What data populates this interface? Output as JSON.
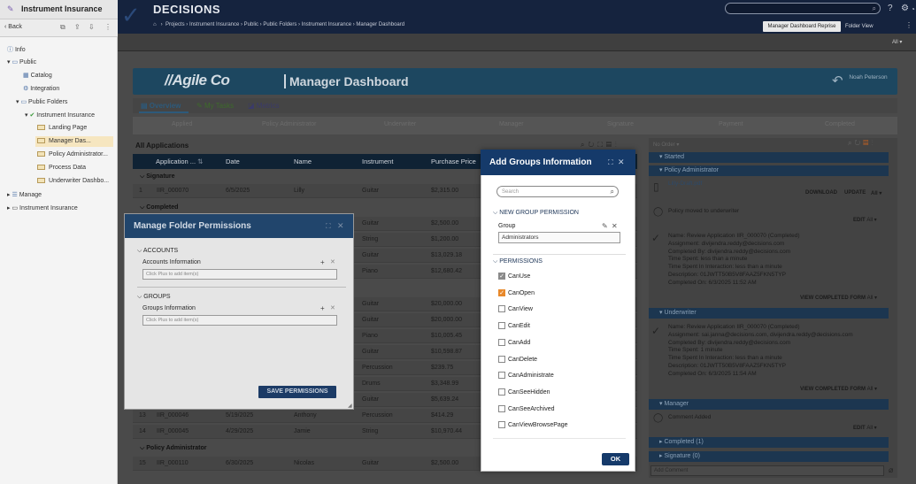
{
  "left_panel": {
    "title": "Instrument Insurance",
    "back": "Back",
    "tree": [
      "Info",
      "Public",
      "Catalog",
      "Integration",
      "Public Folders",
      "Instrument Insurance",
      "Landing Page",
      "Manager Das...",
      "Policy Administrator...",
      "Process Data",
      "Underwriter Dashbo...",
      "Manage",
      "Instrument Insurance"
    ]
  },
  "topbar": {
    "brand": "DECISIONS",
    "breadcrumb": "Projects  ›  Instrument Insurance  ›  Public  ›  Public Folders  ›  Instrument Insurance  ›  Manager Dashboard",
    "reprise_btn": "Manager Dashboard Reprise",
    "folder_view": "Folder View",
    "all": "All"
  },
  "dashboard": {
    "logo": "//Agile Co",
    "title": "Manager Dashboard",
    "user": "Noah Peterson",
    "tabs": [
      "Overview",
      "My Tasks",
      "Metrics"
    ],
    "steps": [
      "Applied",
      "Policy Administrator",
      "Underwriter",
      "Manager",
      "Signature",
      "Payment",
      "Completed"
    ],
    "table_title": "All Applications"
  },
  "table": {
    "headers": [
      "Application ...",
      "Date",
      "Name",
      "Instrument",
      "Purchase Price"
    ],
    "groups": [
      "Signature",
      "Completed",
      "Policy Administrator"
    ],
    "rows": [
      {
        "n": "1",
        "id": "IIR_000070",
        "date": "6/5/2025",
        "name": "Lilly",
        "instrument": "Guitar",
        "price": "$2,315.00"
      },
      {
        "n": "",
        "id": "",
        "date": "",
        "name": "",
        "instrument": "Guitar",
        "price": "$2,500.00"
      },
      {
        "n": "",
        "id": "",
        "date": "",
        "name": "",
        "instrument": "String",
        "price": "$1,200.00"
      },
      {
        "n": "",
        "id": "",
        "date": "",
        "name": "",
        "instrument": "Guitar",
        "price": "$13,029.18"
      },
      {
        "n": "",
        "id": "",
        "date": "",
        "name": "",
        "instrument": "Piano",
        "price": "$12,680.42"
      },
      {
        "n": "",
        "id": "",
        "date": "",
        "name": "",
        "instrument": "Guitar",
        "price": "$20,000.00"
      },
      {
        "n": "",
        "id": "",
        "date": "",
        "name": "",
        "instrument": "Guitar",
        "price": "$20,000.00"
      },
      {
        "n": "",
        "id": "",
        "date": "",
        "name": "",
        "instrument": "Piano",
        "price": "$10,005.45"
      },
      {
        "n": "",
        "id": "",
        "date": "",
        "name": "",
        "instrument": "Guitar",
        "price": "$10,598.87"
      },
      {
        "n": "",
        "id": "",
        "date": "",
        "name": "",
        "instrument": "Percussion",
        "price": "$239.75"
      },
      {
        "n": "",
        "id": "",
        "date": "",
        "name": "",
        "instrument": "Drums",
        "price": "$3,348.99"
      },
      {
        "n": "",
        "id": "",
        "date": "",
        "name": "",
        "instrument": "Guitar",
        "price": "$5,639.24"
      },
      {
        "n": "13",
        "id": "IIR_000046",
        "date": "5/19/2025",
        "name": "Anthony",
        "instrument": "Percussion",
        "price": "$414.29"
      },
      {
        "n": "14",
        "id": "IIR_000045",
        "date": "4/29/2025",
        "name": "Jamie",
        "instrument": "String",
        "price": "$10,970.44"
      },
      {
        "n": "15",
        "id": "IIR_000110",
        "date": "6/30/2025",
        "name": "Nicolas",
        "instrument": "Guitar",
        "price": "$2,500.00"
      }
    ]
  },
  "timeline": {
    "sections": [
      "Started",
      "Policy Administrator",
      "Underwriter",
      "Manager",
      "Completed (1)",
      "Signature (0)"
    ],
    "file": "Lilly-Draft.pdf",
    "download": "DOWNLOAD",
    "update": "UPDATE",
    "all": "All",
    "edit": "EDIT",
    "policy_moved": "Policy moved to underwriter",
    "review1": [
      "Name: Review Application IIR_000070 (Completed)",
      "Assignment: divijendra.reddy@decisions.com",
      "Completed By: divijendra.reddy@decisions.com",
      "Time Spent: less than a minute",
      "Time Spent In Interaction: less than a minute",
      "Description: 01JWTT50B5V8FAAZ5FKN5TYP",
      "Completed On: 6/3/2025 11:52 AM"
    ],
    "view_completed": "VIEW COMPLETED FORM",
    "review2": [
      "Name: Review Application IIR_000070 (Completed)",
      "Assignment: sai.janna@decisions.com, divijendra.reddy@decisions.com",
      "Completed By: divijendra.reddy@decisions.com",
      "Time Spent: 1 minute",
      "Time Spent In Interaction: less than a minute",
      "Description: 01JWTT50B5V8FAAZ5FKN5TYP",
      "Completed On: 6/3/2025 11:54 AM"
    ],
    "comment": "Comment Added",
    "add_comment": "Add Comment"
  },
  "manage_dialog": {
    "title": "Manage Folder Permissions",
    "accounts_header": "ACCOUNTS",
    "accounts_info": "Accounts Information",
    "accounts_placeholder": "Click Plus to add item(s)",
    "groups_header": "GROUPS",
    "groups_info": "Groups Information",
    "groups_placeholder": "Click Plus to add item(s)",
    "save": "SAVE PERMISSIONS"
  },
  "groups_dialog": {
    "title": "Add Groups Information",
    "search_placeholder": "Search",
    "new_group_header": "NEW GROUP PERMISSION",
    "group_label": "Group",
    "group_value": "Administrators",
    "permissions_header": "PERMISSIONS",
    "permissions": [
      {
        "label": "CanUse",
        "checked": true,
        "color": "#8a8a8a"
      },
      {
        "label": "CanOpen",
        "checked": true,
        "color": "#e8892b"
      },
      {
        "label": "CanView",
        "checked": false
      },
      {
        "label": "CanEdit",
        "checked": false
      },
      {
        "label": "CanAdd",
        "checked": false
      },
      {
        "label": "CanDelete",
        "checked": false
      },
      {
        "label": "CanAdministrate",
        "checked": false
      },
      {
        "label": "CanSeeHidden",
        "checked": false
      },
      {
        "label": "CanSeeArchived",
        "checked": false
      },
      {
        "label": "CanViewBrowsePage",
        "checked": false
      }
    ],
    "ok": "OK"
  }
}
